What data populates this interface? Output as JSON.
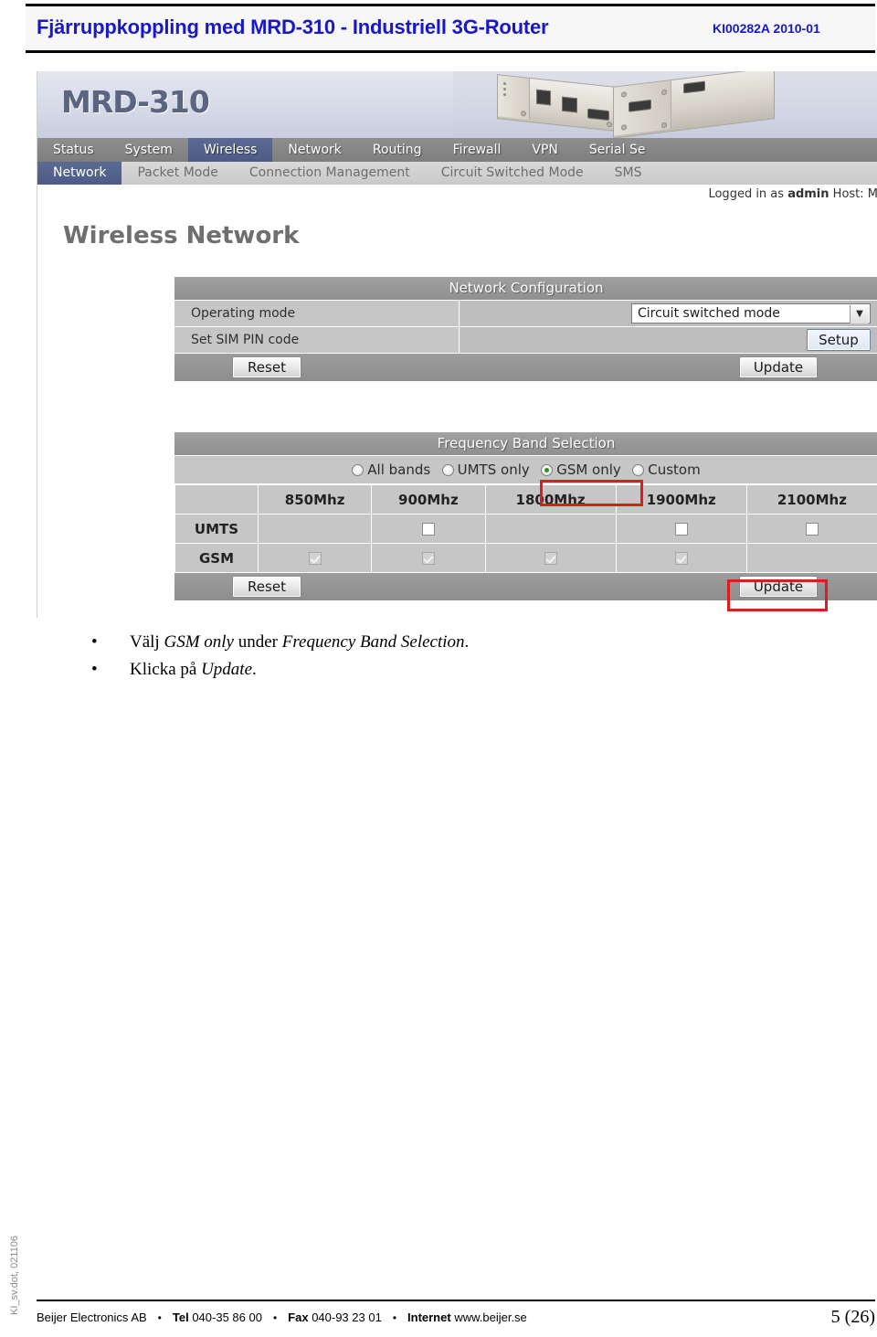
{
  "header": {
    "title": "Fjärruppkoppling med MRD-310 - Industriell 3G-Router",
    "doc_id": "KI00282A 2010-01",
    "title_color": "#1818c8"
  },
  "screenshot": {
    "logo": "MRD-310",
    "primary_nav": [
      {
        "label": "Status",
        "active": false
      },
      {
        "label": "System",
        "active": false
      },
      {
        "label": "Wireless",
        "active": true
      },
      {
        "label": "Network",
        "active": false
      },
      {
        "label": "Routing",
        "active": false
      },
      {
        "label": "Firewall",
        "active": false
      },
      {
        "label": "VPN",
        "active": false
      },
      {
        "label": "Serial Se",
        "active": false
      }
    ],
    "secondary_nav": [
      {
        "label": "Network",
        "active": true
      },
      {
        "label": "Packet Mode",
        "active": false
      },
      {
        "label": "Connection Management",
        "active": false
      },
      {
        "label": "Circuit Switched Mode",
        "active": false
      },
      {
        "label": "SMS",
        "active": false
      }
    ],
    "login_status": {
      "prefix": "Logged in as ",
      "user": "admin",
      "suffix": " Host: M"
    },
    "page_heading": "Wireless Network",
    "network_configuration": {
      "title": "Network Configuration",
      "rows": [
        {
          "label": "Operating mode",
          "value": "Circuit switched mode",
          "control": "select"
        },
        {
          "label": "Set SIM PIN code",
          "value": "Setup",
          "control": "button"
        }
      ],
      "reset_label": "Reset",
      "update_label": "Update"
    },
    "frequency_band_selection": {
      "title": "Frequency Band Selection",
      "modes": [
        {
          "label": "All bands",
          "selected": false
        },
        {
          "label": "UMTS only",
          "selected": false
        },
        {
          "label": "GSM only",
          "selected": true
        },
        {
          "label": "Custom",
          "selected": false
        }
      ],
      "band_headers": [
        "850Mhz",
        "900Mhz",
        "1800Mhz",
        "1900Mhz",
        "2100Mhz"
      ],
      "rows": [
        {
          "name": "UMTS",
          "cells": [
            "none",
            "unchecked",
            "none",
            "unchecked",
            "unchecked"
          ]
        },
        {
          "name": "GSM",
          "cells": [
            "checked",
            "checked",
            "checked",
            "checked",
            "none"
          ]
        }
      ],
      "reset_label": "Reset",
      "update_label": "Update"
    },
    "highlight_color": "#e01b1b"
  },
  "instructions": [
    {
      "parts": [
        {
          "text": "Välj ",
          "italic": false
        },
        {
          "text": "GSM only",
          "italic": true
        },
        {
          "text": " under ",
          "italic": false
        },
        {
          "text": "Frequency Band Selection",
          "italic": true
        },
        {
          "text": ".",
          "italic": false
        }
      ]
    },
    {
      "parts": [
        {
          "text": "Klicka på ",
          "italic": false
        },
        {
          "text": "Update",
          "italic": true
        },
        {
          "text": ".",
          "italic": false
        }
      ]
    }
  ],
  "side_stamp": "KI_sv.dot, 021106",
  "footer": {
    "company": "Beijer Electronics AB",
    "tel_label": "Tel",
    "tel_value": "040-35 86 00",
    "fax_label": "Fax",
    "fax_value": "040-93 23 01",
    "internet_label": "Internet",
    "internet_value": "www.beijer.se",
    "page_number": "5 (26)",
    "separator": "•"
  }
}
